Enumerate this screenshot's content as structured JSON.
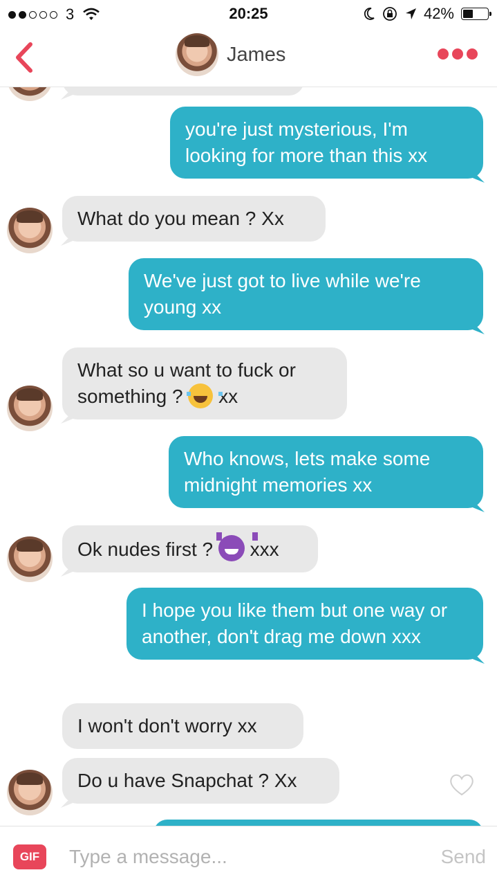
{
  "status_bar": {
    "carrier": "3",
    "time": "20:25",
    "battery": "42%",
    "battery_level": 0.42,
    "signal_bars_filled": 2,
    "signal_bars_total": 5
  },
  "header": {
    "name": "James"
  },
  "messages": [
    {
      "from": "them",
      "text": ""
    },
    {
      "from": "me",
      "text": "you're just mysterious, I'm looking for more than this xx"
    },
    {
      "from": "them",
      "text": "What do you mean ? Xx"
    },
    {
      "from": "me",
      "text": "We've just got to live while we're young xx"
    },
    {
      "from": "them",
      "text_a": "What so u want to fuck or something ?",
      "emoji": "face-with-tears-of-joy",
      "text_b": "xx"
    },
    {
      "from": "me",
      "text": "Who knows, lets make some midnight memories xx"
    },
    {
      "from": "them",
      "text_a": "Ok nudes first ?",
      "emoji": "smiling-devil",
      "text_b": "xxx"
    },
    {
      "from": "me",
      "text": "I hope you like them but one way or another, don't drag me down xxx"
    },
    {
      "from": "them",
      "text": "I won't don't worry xx"
    },
    {
      "from": "them",
      "text": "Do u have Snapchat ? Xx"
    },
    {
      "from": "me",
      "text": ""
    }
  ],
  "input": {
    "gif_label": "GIF",
    "placeholder": "Type a message...",
    "send_label": "Send"
  },
  "colors": {
    "accent": "#e8465a",
    "sent_bubble": "#2eb1c8",
    "received_bubble": "#e8e8e8"
  }
}
